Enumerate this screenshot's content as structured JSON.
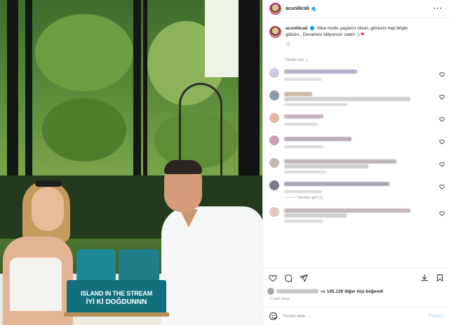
{
  "header": {
    "username": "acunilicali",
    "more_icon": "more-dots-icon"
  },
  "caption": {
    "username": "acunilicali",
    "text_line1": "Nice mutlu yaşların olsun, gözlerin hep böyle",
    "text_line2": "gülsün.. Devamını biliyorsun zaten :)",
    "heart_emoji": "❤",
    "time": "1y"
  },
  "sort_label": "Senin için ⌄",
  "photo": {
    "cake_line1": "ISLAND IN THE STREAM",
    "cake_line2": "İYİ Kİ DOĞDUNNN"
  },
  "comments": [
    {
      "name_width": 104,
      "text_width": 0,
      "meta_width": 54,
      "replies": ""
    },
    {
      "name_width": 40,
      "text_width": 180,
      "meta_width": 90,
      "replies": ""
    },
    {
      "name_width": 56,
      "text_width": 0,
      "meta_width": 48,
      "replies": ""
    },
    {
      "name_width": 96,
      "text_width": 0,
      "meta_width": 56,
      "replies": ""
    },
    {
      "name_width": 160,
      "text_width": 120,
      "meta_width": 60,
      "replies": ""
    },
    {
      "name_width": 150,
      "text_width": 0,
      "meta_width": 54,
      "replies": "——— Yanıtları gör (1)"
    },
    {
      "name_width": 180,
      "text_width": 90,
      "meta_width": 56,
      "replies": ""
    }
  ],
  "likes": {
    "text_prefix": "ve",
    "count": "145.120",
    "text_suffix": "diğer kişi beğendi"
  },
  "post_time": "7 saat önce",
  "composer": {
    "placeholder": "Yorum ekle...",
    "post_label": "Paylaş"
  },
  "colors": {
    "accent": "#0095f6",
    "muted": "#8e8e8e",
    "text": "#262626",
    "cake_teal": "#12707d"
  },
  "action_icons": [
    "heart-icon",
    "comment-icon",
    "share-icon",
    "download-icon",
    "bookmark-icon"
  ]
}
